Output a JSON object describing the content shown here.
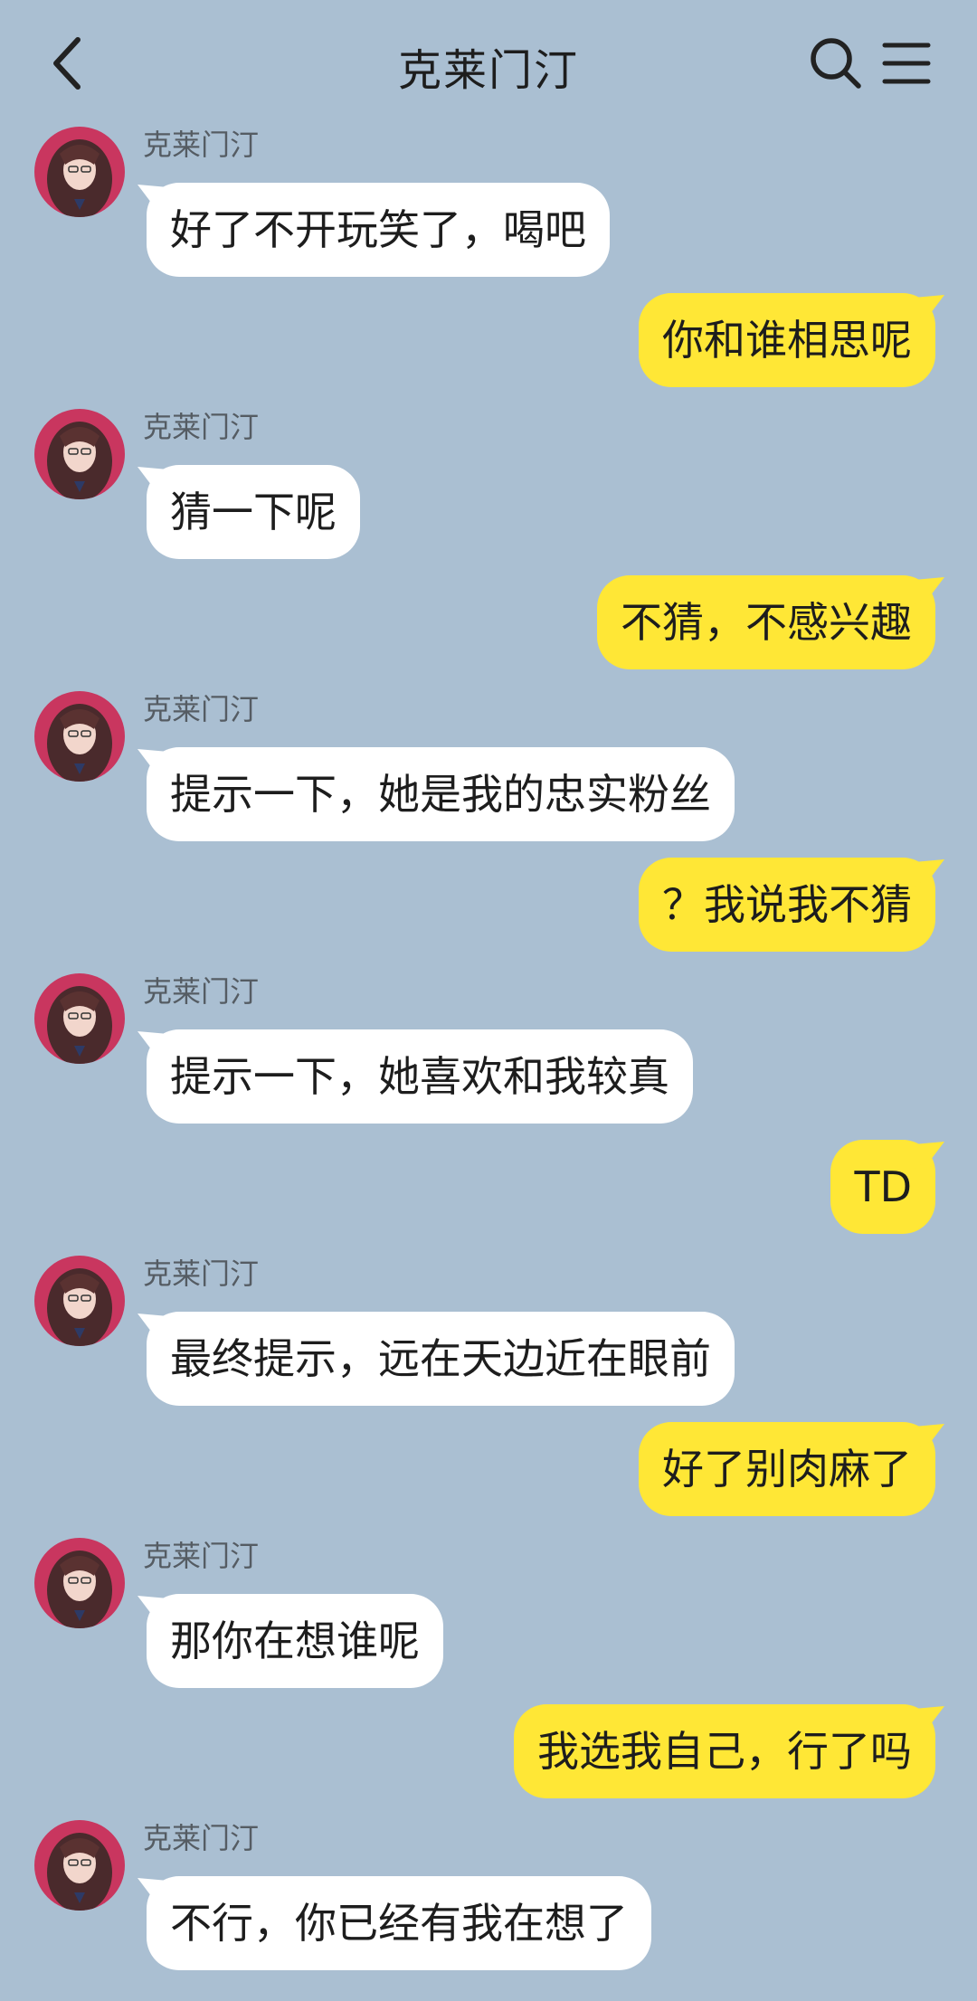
{
  "header": {
    "title": "克莱门汀"
  },
  "messages": [
    {
      "from": "contact",
      "sender": "克莱门汀",
      "text": "好了不开玩笑了，喝吧"
    },
    {
      "from": "me",
      "text": "你和谁相思呢"
    },
    {
      "from": "contact",
      "sender": "克莱门汀",
      "text": "猜一下呢"
    },
    {
      "from": "me",
      "text": "不猜，不感兴趣"
    },
    {
      "from": "contact",
      "sender": "克莱门汀",
      "text": "提示一下，她是我的忠实粉丝"
    },
    {
      "from": "me",
      "text": "？我说我不猜"
    },
    {
      "from": "contact",
      "sender": "克莱门汀",
      "text": "提示一下，她喜欢和我较真"
    },
    {
      "from": "me",
      "text": "TD"
    },
    {
      "from": "contact",
      "sender": "克莱门汀",
      "text": "最终提示，远在天边近在眼前"
    },
    {
      "from": "me",
      "text": "好了别肉麻了"
    },
    {
      "from": "contact",
      "sender": "克莱门汀",
      "text": "那你在想谁呢"
    },
    {
      "from": "me",
      "text": "我选我自己，行了吗"
    },
    {
      "from": "contact",
      "sender": "克莱门汀",
      "text": "不行，你已经有我在想了"
    }
  ],
  "colors": {
    "background": "#aabfd2",
    "outgoing_bubble": "#ffe736",
    "incoming_bubble": "#ffffff"
  },
  "icons": {
    "back": "back-chevron-icon",
    "search": "search-icon",
    "menu": "menu-icon"
  }
}
